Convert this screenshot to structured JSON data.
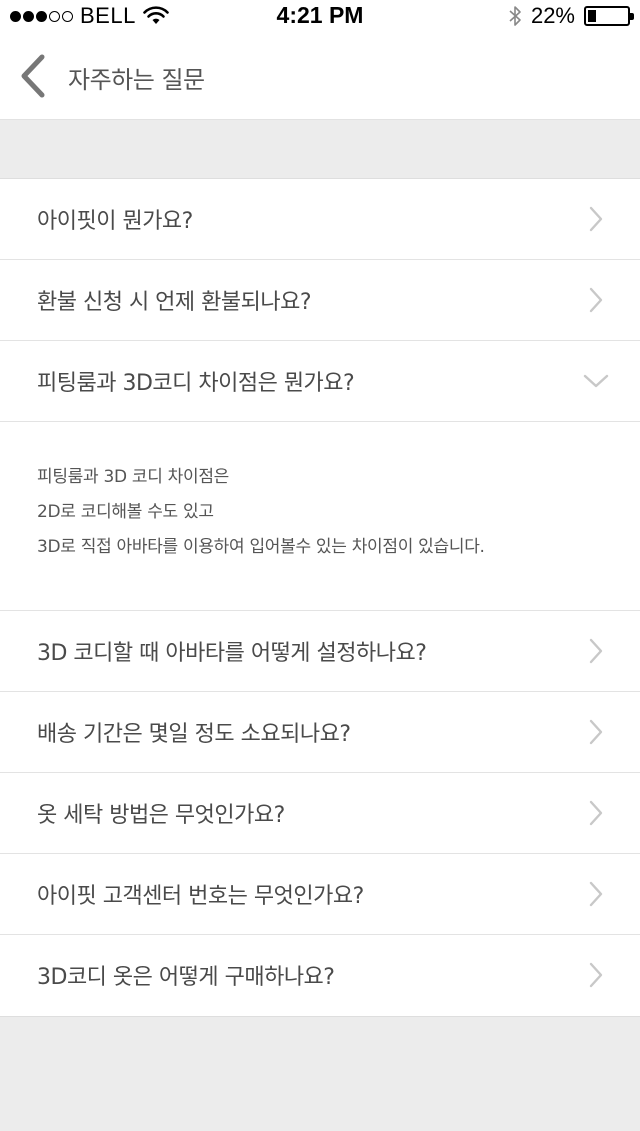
{
  "status_bar": {
    "carrier": "BELL",
    "time": "4:21 PM",
    "battery_percent": "22%",
    "battery_level": 0.22,
    "signal_bars_filled": 3,
    "signal_bars_total": 5
  },
  "header": {
    "title": "자주하는 질문",
    "back_icon": "chevron-left-icon"
  },
  "faq": {
    "items": [
      {
        "question": "아이핏이 뭔가요?",
        "expanded": false
      },
      {
        "question": "환불 신청 시 언제 환불되나요?",
        "expanded": false
      },
      {
        "question": "피팅룸과 3D코디 차이점은 뭔가요?",
        "expanded": true
      },
      {
        "question": "3D 코디할 때 아바타를 어떻게 설정하나요?",
        "expanded": false
      },
      {
        "question": "배송 기간은 몇일 정도 소요되나요?",
        "expanded": false
      },
      {
        "question": "옷 세탁 방법은 무엇인가요?",
        "expanded": false
      },
      {
        "question": "아이핏 고객센터 번호는 무엇인가요?",
        "expanded": false
      },
      {
        "question": "3D코디 옷은 어떻게 구매하나요?",
        "expanded": false
      }
    ],
    "expanded_answer": [
      "피팅룸과 3D 코디 차이점은",
      "2D로 코디해볼 수도 있고",
      "3D로 직접 아바타를 이용하여 입어볼수 있는 차이점이 있습니다."
    ]
  },
  "colors": {
    "background": "#ececec",
    "surface": "#ffffff",
    "text": "#4a4a4a",
    "chevron": "#c8c8c8",
    "back_arrow": "#777777"
  }
}
